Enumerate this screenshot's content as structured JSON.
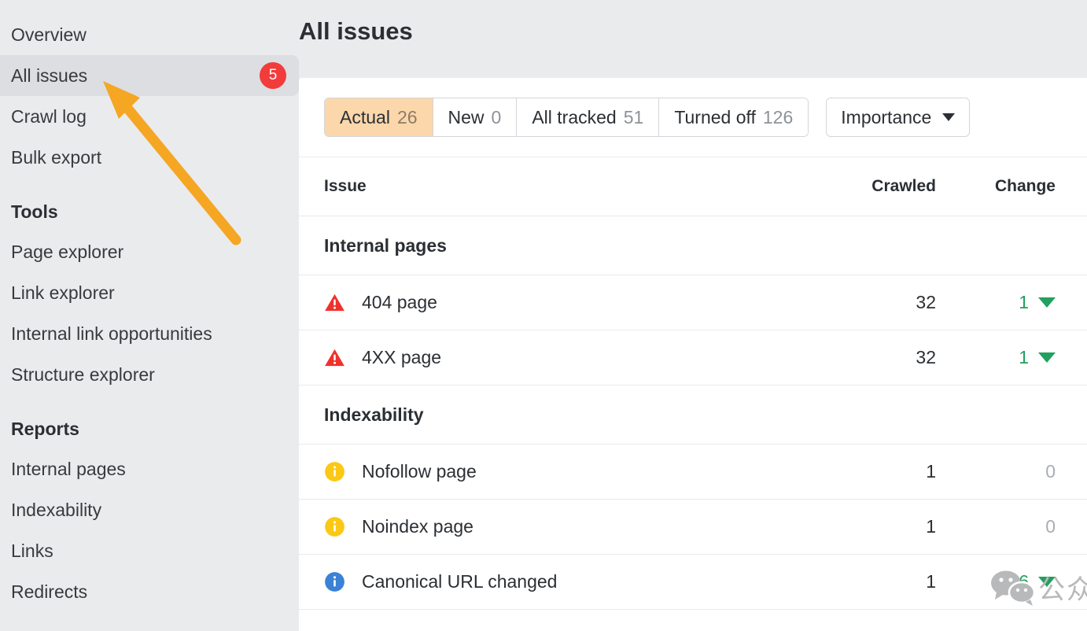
{
  "colors": {
    "app_bg": "#eaebed",
    "card_bg": "#ffffff",
    "sidebar_active_bg": "#dcdee1",
    "badge_red": "#f23b3b",
    "tab_active_bg": "#fbd7ab",
    "change_green": "#22a05f",
    "icon_error_red": "#f0312c",
    "icon_warn_yellow": "#fbc815",
    "icon_info_blue": "#3b82d6",
    "annotation_orange": "#f5a623",
    "watermark_grey": "#b7b9bb"
  },
  "sidebar": {
    "items": [
      {
        "label": "Overview",
        "active": false,
        "badge": null
      },
      {
        "label": "All issues",
        "active": true,
        "badge": "5"
      },
      {
        "label": "Crawl log",
        "active": false,
        "badge": null
      },
      {
        "label": "Bulk export",
        "active": false,
        "badge": null
      }
    ],
    "groups": [
      {
        "title": "Tools",
        "items": [
          {
            "label": "Page explorer"
          },
          {
            "label": "Link explorer"
          },
          {
            "label": "Internal link opportunities"
          },
          {
            "label": "Structure explorer"
          }
        ]
      },
      {
        "title": "Reports",
        "items": [
          {
            "label": "Internal pages"
          },
          {
            "label": "Indexability"
          },
          {
            "label": "Links"
          },
          {
            "label": "Redirects"
          }
        ]
      }
    ]
  },
  "header": {
    "title": "All issues"
  },
  "tabs": [
    {
      "label": "Actual",
      "count": "26",
      "active": true
    },
    {
      "label": "New",
      "count": "0",
      "active": false
    },
    {
      "label": "All tracked",
      "count": "51",
      "active": false
    },
    {
      "label": "Turned off",
      "count": "126",
      "active": false
    }
  ],
  "filter": {
    "label": "Importance",
    "icon": "chevron-down-icon"
  },
  "table": {
    "columns": [
      "Issue",
      "Crawled",
      "Change"
    ],
    "groups": [
      {
        "title": "Internal pages",
        "rows": [
          {
            "icon": "error-triangle-icon",
            "severity": "error",
            "issue": "404 page",
            "crawled": "32",
            "change": "1",
            "direction": "down"
          },
          {
            "icon": "error-triangle-icon",
            "severity": "error",
            "issue": "4XX page",
            "crawled": "32",
            "change": "1",
            "direction": "down"
          }
        ]
      },
      {
        "title": "Indexability",
        "rows": [
          {
            "icon": "warning-info-icon",
            "severity": "warning",
            "issue": "Nofollow page",
            "crawled": "1",
            "change": "0",
            "direction": "none"
          },
          {
            "icon": "warning-info-icon",
            "severity": "warning",
            "issue": "Noindex page",
            "crawled": "1",
            "change": "0",
            "direction": "none"
          },
          {
            "icon": "info-icon",
            "severity": "info",
            "issue": "Canonical URL changed",
            "crawled": "1",
            "change": "6",
            "direction": "down"
          }
        ]
      }
    ]
  },
  "watermark": {
    "icon": "wechat-icon",
    "text": "公众号 · 若凡SEO优化"
  },
  "annotation": {
    "type": "arrow",
    "points_to": "sidebar-item-all-issues"
  }
}
